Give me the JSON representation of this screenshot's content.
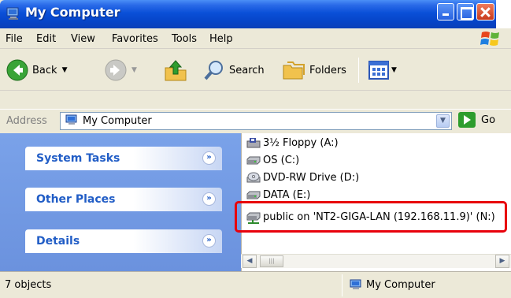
{
  "window": {
    "title": "My Computer"
  },
  "menu": {
    "items": [
      "File",
      "Edit",
      "View",
      "Favorites",
      "Tools",
      "Help"
    ]
  },
  "toolbar": {
    "back_label": "Back",
    "search_label": "Search",
    "folders_label": "Folders"
  },
  "address": {
    "label": "Address",
    "value": "My Computer",
    "go_label": "Go"
  },
  "task_pane": {
    "groups": [
      "System Tasks",
      "Other Places",
      "Details"
    ]
  },
  "drives": [
    {
      "name": "3½ Floppy (A:)",
      "icon": "floppy-drive-icon"
    },
    {
      "name": "OS (C:)",
      "icon": "hard-drive-icon"
    },
    {
      "name": "DVD-RW Drive (D:)",
      "icon": "dvd-drive-icon"
    },
    {
      "name": "DATA (E:)",
      "icon": "hard-drive-icon"
    },
    {
      "name": "public on 'NT2-GIGA-LAN (192.168.11.9)' (N:)",
      "icon": "network-drive-icon"
    }
  ],
  "status": {
    "left": "7 objects",
    "right": "My Computer"
  },
  "colors": {
    "highlight": "#e8000b",
    "title_bar": "#0a50d8",
    "task_pane": "#7aa2e9"
  }
}
